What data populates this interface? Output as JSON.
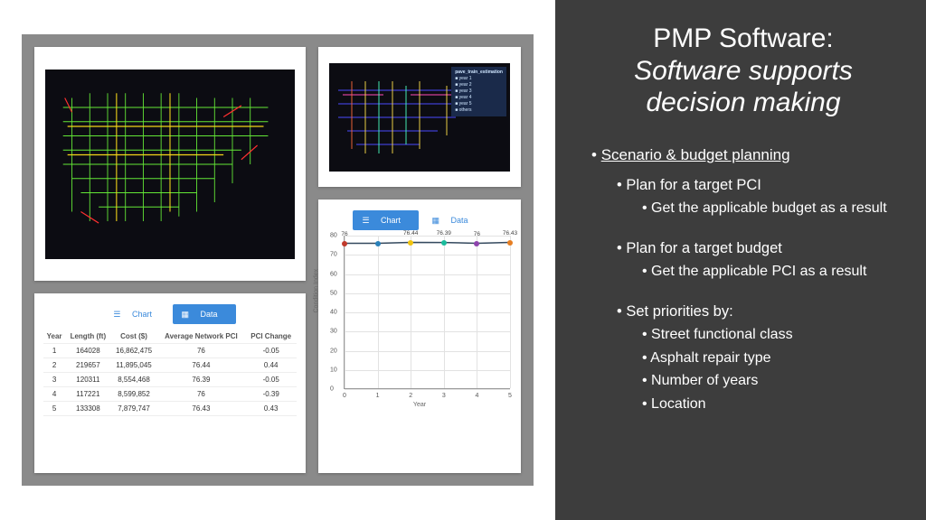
{
  "right": {
    "title1": "PMP Software:",
    "title2": "Software supports decision making",
    "l1": "Scenario & budget planning",
    "l2a": "Plan for a target PCI",
    "l3a": "Get the applicable budget as a result",
    "l2b": "Plan for a target budget",
    "l3b": "Get the applicable PCI as a result",
    "l2c": "Set priorities by:",
    "p1": "Street functional class",
    "p2": "Asphalt repair type",
    "p3": "Number of years",
    "p4": "Location"
  },
  "toggle": {
    "chart": "Chart",
    "data": "Data"
  },
  "table": {
    "headers": [
      "Year",
      "Length (ft)",
      "Cost ($)",
      "Average Network PCI",
      "PCI Change"
    ],
    "rows": [
      [
        "1",
        "164028",
        "16,862,475",
        "76",
        "-0.05"
      ],
      [
        "2",
        "219657",
        "11,895,045",
        "76.44",
        "0.44"
      ],
      [
        "3",
        "120311",
        "8,554,468",
        "76.39",
        "-0.05"
      ],
      [
        "4",
        "117221",
        "8,599,852",
        "76",
        "-0.39"
      ],
      [
        "5",
        "133308",
        "7,879,747",
        "76.43",
        "0.43"
      ]
    ]
  },
  "chart_data": {
    "type": "line",
    "title": "",
    "xlabel": "Year",
    "ylabel": "Condition Index",
    "ylim": [
      0,
      80
    ],
    "yticks": [
      0,
      10,
      20,
      30,
      40,
      50,
      60,
      70,
      80
    ],
    "categories": [
      "0",
      "1",
      "2",
      "3",
      "4",
      "5"
    ],
    "values": [
      76,
      76,
      76.44,
      76.39,
      76,
      76.43
    ],
    "data_labels": [
      "76",
      "",
      "76.44",
      "76.39",
      "76",
      "76.43"
    ],
    "colors": [
      "#c0392b",
      "#2980b9",
      "#f1c40f",
      "#1abc9c",
      "#8e44ad",
      "#e67e22"
    ]
  },
  "legend": {
    "title": "pave_train_estimation",
    "items": [
      "year 1",
      "year 2",
      "year 3",
      "year 4",
      "year 5",
      "others"
    ]
  }
}
